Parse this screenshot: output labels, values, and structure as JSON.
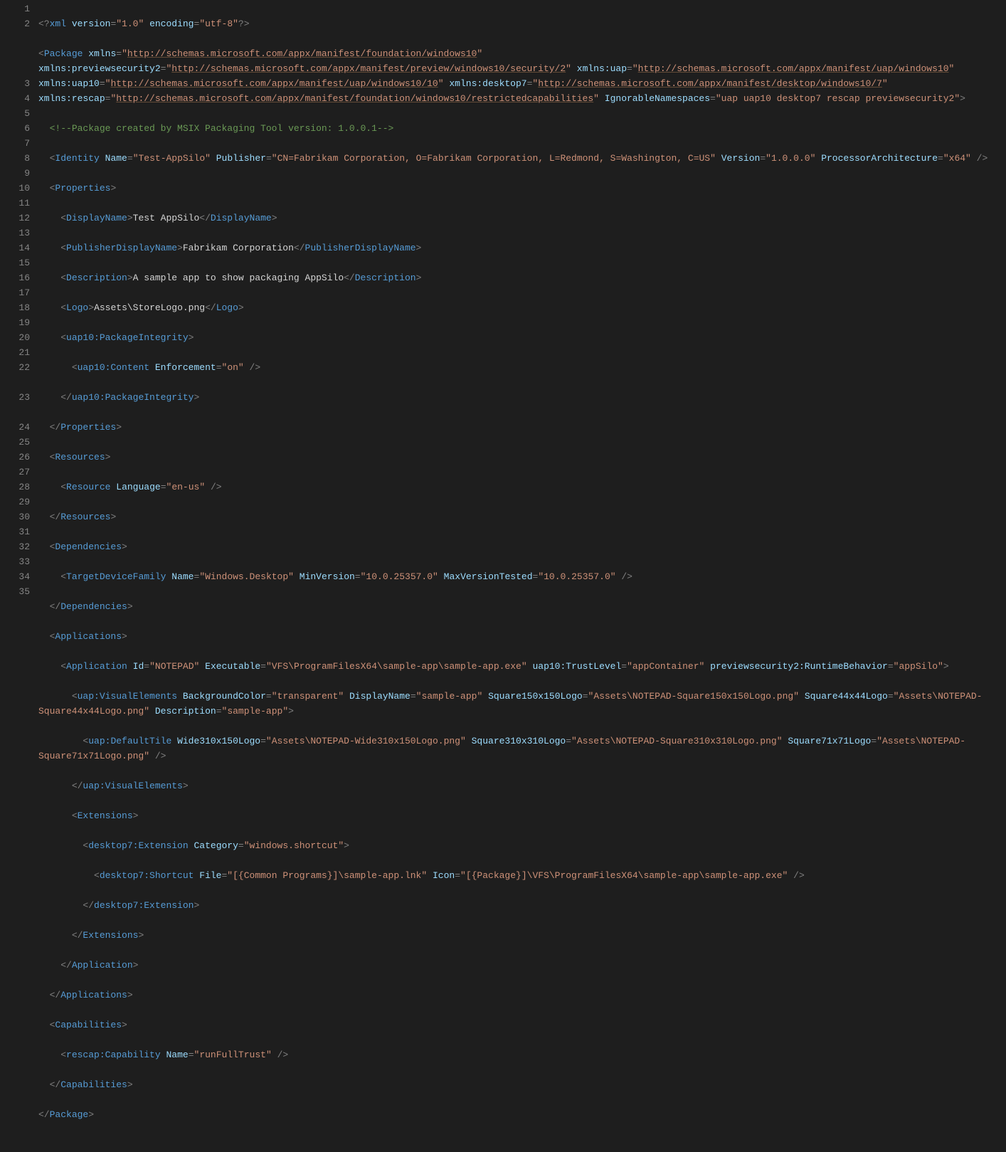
{
  "lineNumbers": [
    "1",
    "2",
    "3",
    "4",
    "5",
    "6",
    "7",
    "8",
    "9",
    "10",
    "11",
    "12",
    "13",
    "14",
    "15",
    "16",
    "17",
    "18",
    "19",
    "20",
    "21",
    "22",
    "23",
    "24",
    "25",
    "26",
    "27",
    "28",
    "29",
    "30",
    "31",
    "32",
    "33",
    "34",
    "35"
  ],
  "xml": {
    "declaration": "<?xml version=\"1.0\" encoding=\"utf-8\"?>",
    "package": {
      "xmlns": "http://schemas.microsoft.com/appx/manifest/foundation/windows10",
      "xmlns_previewsecurity2": "http://schemas.microsoft.com/appx/manifest/preview/windows10/security/2",
      "xmlns_uap": "http://schemas.microsoft.com/appx/manifest/uap/windows10",
      "xmlns_uap10": "http://schemas.microsoft.com/appx/manifest/uap/windows10/10",
      "xmlns_desktop7": "http://schemas.microsoft.com/appx/manifest/desktop/windows10/7",
      "xmlns_rescap": "http://schemas.microsoft.com/appx/manifest/foundation/windows10/restrictedcapabilities",
      "ignorableNamespaces": "uap uap10 desktop7 rescap previewsecurity2"
    },
    "comment": "Package created by MSIX Packaging Tool version: 1.0.0.1",
    "identity": {
      "name": "Test-AppSilo",
      "publisher": "CN=Fabrikam Corporation, O=Fabrikam Corporation, L=Redmond, S=Washington, C=US",
      "version": "1.0.0.0",
      "processorArchitecture": "x64"
    },
    "properties": {
      "displayName": "Test AppSilo",
      "publisherDisplayName": "Fabrikam Corporation",
      "description": "A sample app to show packaging AppSilo",
      "logo": "Assets\\StoreLogo.png",
      "packageIntegrity": {
        "contentEnforcement": "on"
      }
    },
    "resources": {
      "language": "en-us"
    },
    "dependencies": {
      "targetDeviceFamily": {
        "name": "Windows.Desktop",
        "minVersion": "10.0.25357.0",
        "maxVersionTested": "10.0.25357.0"
      }
    },
    "applications": {
      "application": {
        "id": "NOTEPAD",
        "executable": "VFS\\ProgramFilesX64\\sample-app\\sample-app.exe",
        "trustLevel": "appContainer",
        "runtimeBehavior": "appSilo",
        "visualElements": {
          "backgroundColor": "transparent",
          "displayName": "sample-app",
          "square150x150Logo": "Assets\\NOTEPAD-Square150x150Logo.png",
          "square44x44Logo": "Assets\\NOTEPAD-Square44x44Logo.png",
          "description": "sample-app",
          "defaultTile": {
            "wide310x150Logo": "Assets\\NOTEPAD-Wide310x150Logo.png",
            "square310x310Logo": "Assets\\NOTEPAD-Square310x310Logo.png",
            "square71x71Logo": "Assets\\NOTEPAD-Square71x71Logo.png"
          }
        },
        "extensions": {
          "desktop7Extension": {
            "category": "windows.shortcut",
            "shortcut": {
              "file": "[{Common Programs}]\\sample-app.lnk",
              "icon": "[{Package}]\\VFS\\ProgramFilesX64\\sample-app\\sample-app.exe"
            }
          }
        }
      }
    },
    "capabilities": {
      "rescapCapabilityName": "runFullTrust"
    }
  }
}
